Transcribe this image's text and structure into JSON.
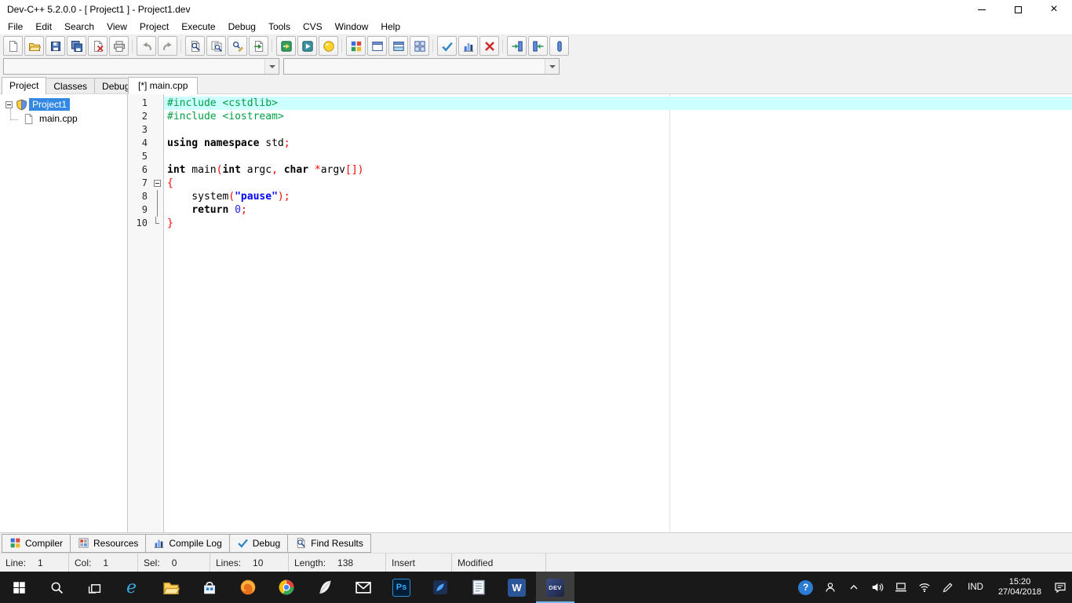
{
  "window": {
    "title": "Dev-C++ 5.2.0.0 - [ Project1 ] - Project1.dev"
  },
  "menu_items": [
    "File",
    "Edit",
    "Search",
    "View",
    "Project",
    "Execute",
    "Debug",
    "Tools",
    "CVS",
    "Window",
    "Help"
  ],
  "toolbar_groups": [
    {
      "buttons": [
        {
          "name": "new-source",
          "icon": "page"
        },
        {
          "name": "open-file",
          "icon": "folder"
        },
        {
          "name": "save",
          "icon": "floppy"
        },
        {
          "name": "save-all",
          "icon": "floppy-multi"
        },
        {
          "name": "close-file",
          "icon": "page-close"
        },
        {
          "name": "print",
          "icon": "printer"
        }
      ]
    },
    {
      "buttons": [
        {
          "name": "undo",
          "icon": "undo"
        },
        {
          "name": "redo",
          "icon": "redo"
        }
      ]
    },
    {
      "buttons": [
        {
          "name": "find",
          "icon": "find"
        },
        {
          "name": "find-in-files",
          "icon": "find-files"
        },
        {
          "name": "replace",
          "icon": "replace"
        },
        {
          "name": "goto-line",
          "icon": "goto"
        }
      ]
    },
    {
      "buttons": [
        {
          "name": "compile",
          "icon": "compile"
        },
        {
          "name": "run",
          "icon": "run"
        },
        {
          "name": "compile-and-run",
          "icon": "ball"
        }
      ]
    },
    {
      "buttons": [
        {
          "name": "new-project",
          "icon": "grid-color"
        },
        {
          "name": "window-view",
          "icon": "window"
        },
        {
          "name": "split-view",
          "icon": "window-split"
        },
        {
          "name": "window-grid",
          "icon": "grid-outline"
        }
      ]
    },
    {
      "buttons": [
        {
          "name": "syntax-check",
          "icon": "check"
        },
        {
          "name": "profile",
          "icon": "chart"
        },
        {
          "name": "abort-compile",
          "icon": "red-x"
        }
      ]
    },
    {
      "buttons": [
        {
          "name": "prev-bookmark",
          "icon": "door-left"
        },
        {
          "name": "next-bookmark",
          "icon": "door-right"
        },
        {
          "name": "pause-program",
          "icon": "pill"
        }
      ]
    }
  ],
  "combos": {
    "compiler": "",
    "classes": ""
  },
  "panel_tabs": [
    {
      "label": "Project",
      "active": true
    },
    {
      "label": "Classes",
      "active": false
    },
    {
      "label": "Debug",
      "active": false
    }
  ],
  "editor_tabs": [
    {
      "label": "[*] main.cpp",
      "active": true
    }
  ],
  "tree": [
    {
      "label": "Project1"
    },
    {
      "label": "main.cpp"
    }
  ],
  "editor": {
    "lines": [
      {
        "n": "1",
        "hl": true,
        "tokens": [
          {
            "t": "#include <cstdlib>",
            "c": "pre"
          }
        ]
      },
      {
        "n": "2",
        "tokens": [
          {
            "t": "#include <iostream>",
            "c": "pre"
          }
        ]
      },
      {
        "n": "3",
        "tokens": []
      },
      {
        "n": "4",
        "tokens": [
          {
            "t": "using",
            "c": "kw"
          },
          {
            "t": " ",
            "c": "pln"
          },
          {
            "t": "namespace",
            "c": "kw"
          },
          {
            "t": " std",
            "c": "pln"
          },
          {
            "t": ";",
            "c": "pun"
          }
        ]
      },
      {
        "n": "5",
        "tokens": []
      },
      {
        "n": "6",
        "tokens": [
          {
            "t": "int",
            "c": "kw"
          },
          {
            "t": " main",
            "c": "pln"
          },
          {
            "t": "(",
            "c": "pun"
          },
          {
            "t": "int",
            "c": "kw"
          },
          {
            "t": " argc",
            "c": "pln"
          },
          {
            "t": ",",
            "c": "pun"
          },
          {
            "t": " ",
            "c": "pln"
          },
          {
            "t": "char",
            "c": "kw"
          },
          {
            "t": " ",
            "c": "pln"
          },
          {
            "t": "*",
            "c": "pun"
          },
          {
            "t": "argv",
            "c": "pln"
          },
          {
            "t": "[])",
            "c": "pun"
          }
        ]
      },
      {
        "n": "7",
        "fold": "box",
        "tokens": [
          {
            "t": "{",
            "c": "pun"
          }
        ]
      },
      {
        "n": "8",
        "fold": "line",
        "tokens": [
          {
            "t": "    system",
            "c": "pln"
          },
          {
            "t": "(",
            "c": "pun"
          },
          {
            "t": "\"pause\"",
            "c": "str"
          },
          {
            "t": ")",
            "c": "pun"
          },
          {
            "t": ";",
            "c": "pun"
          }
        ]
      },
      {
        "n": "9",
        "fold": "line",
        "tokens": [
          {
            "t": "    ",
            "c": "pln"
          },
          {
            "t": "return",
            "c": "kw"
          },
          {
            "t": " ",
            "c": "pln"
          },
          {
            "t": "0",
            "c": "num"
          },
          {
            "t": ";",
            "c": "pun"
          }
        ]
      },
      {
        "n": "10",
        "fold": "end",
        "tokens": [
          {
            "t": "}",
            "c": "pun"
          }
        ]
      }
    ]
  },
  "bottom_tabs": [
    {
      "label": "Compiler",
      "icon": "grid-color"
    },
    {
      "label": "Resources",
      "icon": "grid-red"
    },
    {
      "label": "Compile Log",
      "icon": "chart"
    },
    {
      "label": "Debug",
      "icon": "check"
    },
    {
      "label": "Find Results",
      "icon": "find"
    }
  ],
  "status": [
    {
      "label": "Line:",
      "value": "1"
    },
    {
      "label": "Col:",
      "value": "1"
    },
    {
      "label": "Sel:",
      "value": "0"
    },
    {
      "label": "Lines:",
      "value": "10"
    },
    {
      "label": "Length:",
      "value": "138"
    },
    {
      "label": "Insert",
      "value": ""
    },
    {
      "label": "Modified",
      "value": ""
    }
  ],
  "taskbar": {
    "apps": [
      {
        "name": "edge",
        "icon": "edge"
      },
      {
        "name": "file-explorer",
        "icon": "folder-big"
      },
      {
        "name": "store",
        "icon": "store"
      },
      {
        "name": "firefox",
        "icon": "firefox"
      },
      {
        "name": "chrome",
        "icon": "chrome"
      },
      {
        "name": "notes",
        "icon": "quill"
      },
      {
        "name": "mail",
        "icon": "mail"
      },
      {
        "name": "photoshop",
        "tile": "ps",
        "label": "Ps"
      },
      {
        "name": "photos",
        "icon": "blue-app"
      },
      {
        "name": "notepad",
        "icon": "notepad"
      },
      {
        "name": "word",
        "tile": "word",
        "label": "W"
      },
      {
        "name": "dev-cpp",
        "tile": "dev",
        "label": "DEV",
        "active": true
      }
    ],
    "tray": {
      "help_glyph": "?",
      "language": "IND",
      "time": "15:20",
      "date": "27/04/2018"
    }
  }
}
